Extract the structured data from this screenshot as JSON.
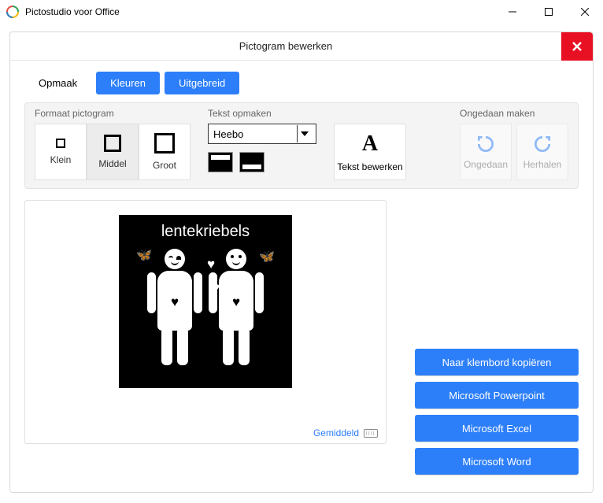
{
  "window": {
    "title": "Pictostudio voor Office"
  },
  "dialog": {
    "title": "Pictogram bewerken"
  },
  "tabs": {
    "opmaak": "Opmaak",
    "kleuren": "Kleuren",
    "uitgebreid": "Uitgebreid"
  },
  "format": {
    "group_label": "Formaat pictogram",
    "small": "Klein",
    "medium": "Middel",
    "large": "Groot"
  },
  "text_format": {
    "group_label": "Tekst opmaken",
    "font": "Heebo",
    "edit_label": "Tekst bewerken"
  },
  "undo": {
    "group_label": "Ongedaan maken",
    "undo": "Ongedaan",
    "redo": "Herhalen"
  },
  "pictogram": {
    "caption": "lentekriebels"
  },
  "difficulty": "Gemiddeld",
  "export": {
    "clipboard": "Naar klembord kopiëren",
    "powerpoint": "Microsoft Powerpoint",
    "excel": "Microsoft Excel",
    "word": "Microsoft Word"
  }
}
